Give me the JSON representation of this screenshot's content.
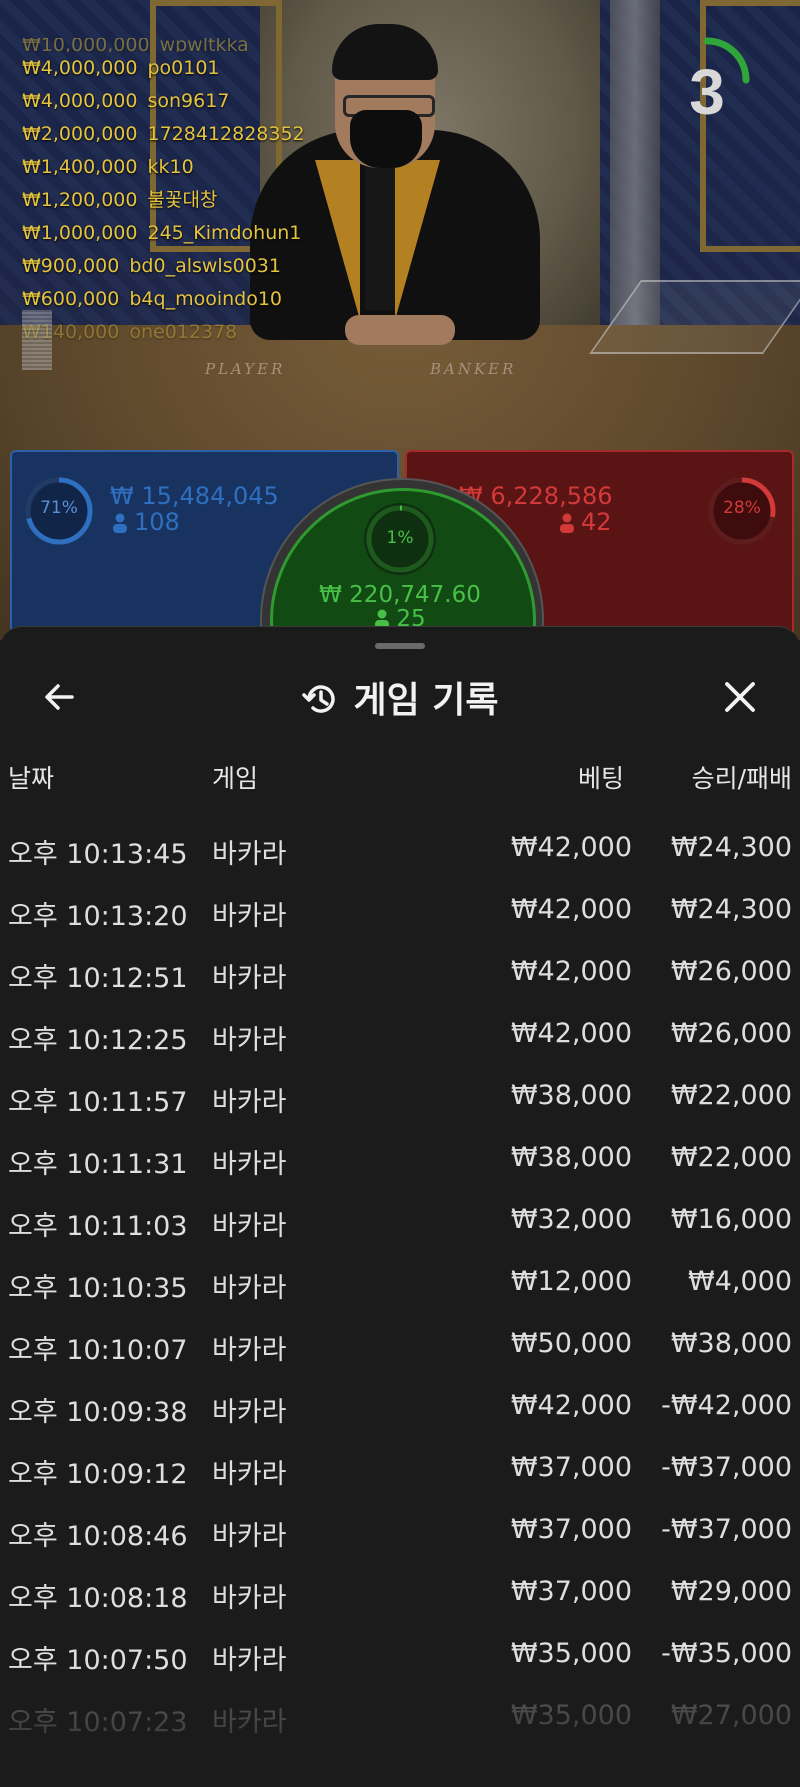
{
  "live_feed": [
    {
      "amount": "₩10,000,000",
      "user": "wpwltkka",
      "faded": true
    },
    {
      "amount": "₩4,000,000",
      "user": "po0101"
    },
    {
      "amount": "₩4,000,000",
      "user": "son9617"
    },
    {
      "amount": "₩2,000,000",
      "user": "1728412828352"
    },
    {
      "amount": "₩1,400,000",
      "user": "kk10"
    },
    {
      "amount": "₩1,200,000",
      "user": "불꽃대창"
    },
    {
      "amount": "₩1,000,000",
      "user": "245_Kimdohun1"
    },
    {
      "amount": "₩900,000",
      "user": "bd0_alswls0031"
    },
    {
      "amount": "₩600,000",
      "user": "b4q_mooindo10"
    },
    {
      "amount": "₩140,000",
      "user": "one012378",
      "faded": true
    }
  ],
  "countdown": "3",
  "table_labels": {
    "player": "PLAYER",
    "banker": "BANKER"
  },
  "player": {
    "percent": "71%",
    "stake": "₩ 15,484,045",
    "players": "108",
    "color": "#2f6fbf"
  },
  "tie": {
    "percent": "1%",
    "stake": "₩ 220,747.60",
    "players": "25",
    "color": "#48c048"
  },
  "banker": {
    "percent": "28%",
    "stake": "₩ 6,228,586",
    "players": "42",
    "color": "#d23a3a"
  },
  "sheet": {
    "title": "게임 기록",
    "back_icon": "arrow-left-icon",
    "history_icon": "history-clock-icon",
    "close_icon": "close-icon",
    "columns": {
      "date": "날짜",
      "game": "게임",
      "bet": "베팅",
      "result": "승리/패배"
    },
    "rows": [
      {
        "date": "오후 10:13:45",
        "game": "바카라",
        "bet": "₩42,000",
        "result": "₩24,300"
      },
      {
        "date": "오후 10:13:20",
        "game": "바카라",
        "bet": "₩42,000",
        "result": "₩24,300"
      },
      {
        "date": "오후 10:12:51",
        "game": "바카라",
        "bet": "₩42,000",
        "result": "₩26,000"
      },
      {
        "date": "오후 10:12:25",
        "game": "바카라",
        "bet": "₩42,000",
        "result": "₩26,000"
      },
      {
        "date": "오후 10:11:57",
        "game": "바카라",
        "bet": "₩38,000",
        "result": "₩22,000"
      },
      {
        "date": "오후 10:11:31",
        "game": "바카라",
        "bet": "₩38,000",
        "result": "₩22,000"
      },
      {
        "date": "오후 10:11:03",
        "game": "바카라",
        "bet": "₩32,000",
        "result": "₩16,000"
      },
      {
        "date": "오후 10:10:35",
        "game": "바카라",
        "bet": "₩12,000",
        "result": "₩4,000"
      },
      {
        "date": "오후 10:10:07",
        "game": "바카라",
        "bet": "₩50,000",
        "result": "₩38,000"
      },
      {
        "date": "오후 10:09:38",
        "game": "바카라",
        "bet": "₩42,000",
        "result": "-₩42,000"
      },
      {
        "date": "오후 10:09:12",
        "game": "바카라",
        "bet": "₩37,000",
        "result": "-₩37,000"
      },
      {
        "date": "오후 10:08:46",
        "game": "바카라",
        "bet": "₩37,000",
        "result": "-₩37,000"
      },
      {
        "date": "오후 10:08:18",
        "game": "바카라",
        "bet": "₩37,000",
        "result": "₩29,000"
      },
      {
        "date": "오후 10:07:50",
        "game": "바카라",
        "bet": "₩35,000",
        "result": "-₩35,000"
      },
      {
        "date": "오후 10:07:23",
        "game": "바카라",
        "bet": "₩35,000",
        "result": "₩27,000",
        "faded": true
      }
    ]
  }
}
